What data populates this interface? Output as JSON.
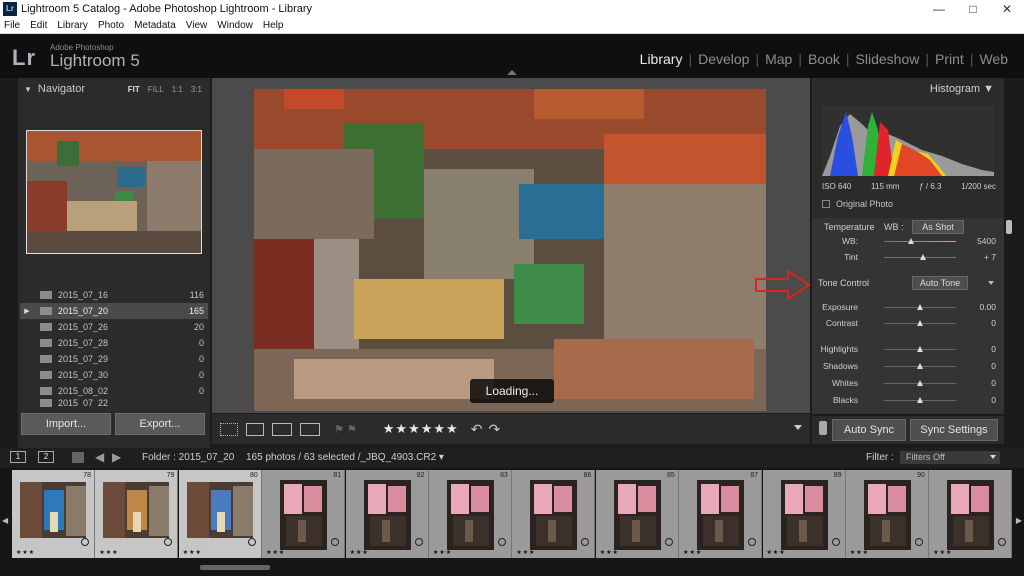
{
  "window": {
    "app_icon": "Lr",
    "title": "Lightroom 5 Catalog - Adobe Photoshop Lightroom - Library",
    "menu": [
      "File",
      "Edit",
      "Library",
      "Photo",
      "Metadata",
      "View",
      "Window",
      "Help"
    ]
  },
  "identity": {
    "logo_mark": "Lr",
    "logo_sub": "Adobe Photoshop",
    "logo_main": "Lightroom 5"
  },
  "modules": [
    "Library",
    "Develop",
    "Map",
    "Book",
    "Slideshow",
    "Print",
    "Web"
  ],
  "active_module": "Library",
  "navigator": {
    "title": "Navigator",
    "zoom": [
      "FIT",
      "FILL",
      "1:1",
      "3:1"
    ]
  },
  "folders": [
    {
      "name": "2015_07_16",
      "count": "116",
      "selected": false
    },
    {
      "name": "2015_07_20",
      "count": "165",
      "selected": true
    },
    {
      "name": "2015_07_26",
      "count": "20",
      "selected": false
    },
    {
      "name": "2015_07_28",
      "count": "0",
      "selected": false
    },
    {
      "name": "2015_07_29",
      "count": "0",
      "selected": false
    },
    {
      "name": "2015_07_30",
      "count": "0",
      "selected": false
    },
    {
      "name": "2015_08_02",
      "count": "0",
      "selected": false
    },
    {
      "name": "2015_07_22",
      "count": "",
      "selected": false
    }
  ],
  "left_buttons": {
    "import": "Import...",
    "export": "Export..."
  },
  "viewer": {
    "loading": "Loading..."
  },
  "toolbar": {
    "stars": "★★★★★★"
  },
  "histogram": {
    "title": "Histogram",
    "iso": "ISO 640",
    "focal": "115 mm",
    "aperture": "ƒ / 6.3",
    "shutter": "1/200 sec",
    "original_photo": "Original Photo"
  },
  "quick_develop": {
    "temperature": "Temperature",
    "wb_label": "WB :",
    "wb_value": "As Shot",
    "wb_row_label": "WB:",
    "wb_row_value": "5400",
    "tint_label": "Tint",
    "tint_value": "+ 7",
    "tone_control": "Tone Control",
    "auto_tone": "Auto Tone",
    "rows": [
      {
        "label": "Exposure",
        "value": "0.00"
      },
      {
        "label": "Contrast",
        "value": "0"
      },
      {
        "label": "Highlights",
        "value": "0"
      },
      {
        "label": "Shadows",
        "value": "0"
      },
      {
        "label": "Whites",
        "value": "0"
      },
      {
        "label": "Blacks",
        "value": "0"
      }
    ]
  },
  "sync": {
    "auto_sync": "Auto Sync",
    "sync_settings": "Sync Settings"
  },
  "filmstrip_bar": {
    "screen1": "1",
    "screen2": "2",
    "folder": "Folder : 2015_07_20",
    "counts": "165 photos / 63 selected /_JBQ_4903.CR2 ▾",
    "filter_label": "Filter :",
    "filter_value": "Filters Off"
  },
  "filmstrip": [
    {
      "num": "78",
      "rating": "★★★",
      "kind": "land-a"
    },
    {
      "num": "79",
      "rating": "★★★",
      "kind": "land-b"
    },
    {
      "num": "80",
      "rating": "★★★",
      "kind": "land-c"
    },
    {
      "num": "81",
      "rating": "★★★",
      "kind": "port"
    },
    {
      "num": "82",
      "rating": "★★★",
      "kind": "port"
    },
    {
      "num": "83",
      "rating": "★★★",
      "kind": "port"
    },
    {
      "num": "86",
      "rating": "★★★",
      "kind": "port"
    },
    {
      "num": "85",
      "rating": "★★★",
      "kind": "port"
    },
    {
      "num": "87",
      "rating": "★★★",
      "kind": "port"
    },
    {
      "num": "89",
      "rating": "★★★",
      "kind": "port"
    },
    {
      "num": "90",
      "rating": "★★★",
      "kind": "port"
    },
    {
      "num": "",
      "rating": "★★★",
      "kind": "port"
    }
  ],
  "colors": {
    "panel": "#2b2b2b",
    "accent_red": "#d8261e",
    "histogram_blue": "#2a4fe0",
    "histogram_green": "#2fb13a",
    "histogram_red": "#e0242a",
    "histogram_yellow": "#f0d21a"
  }
}
